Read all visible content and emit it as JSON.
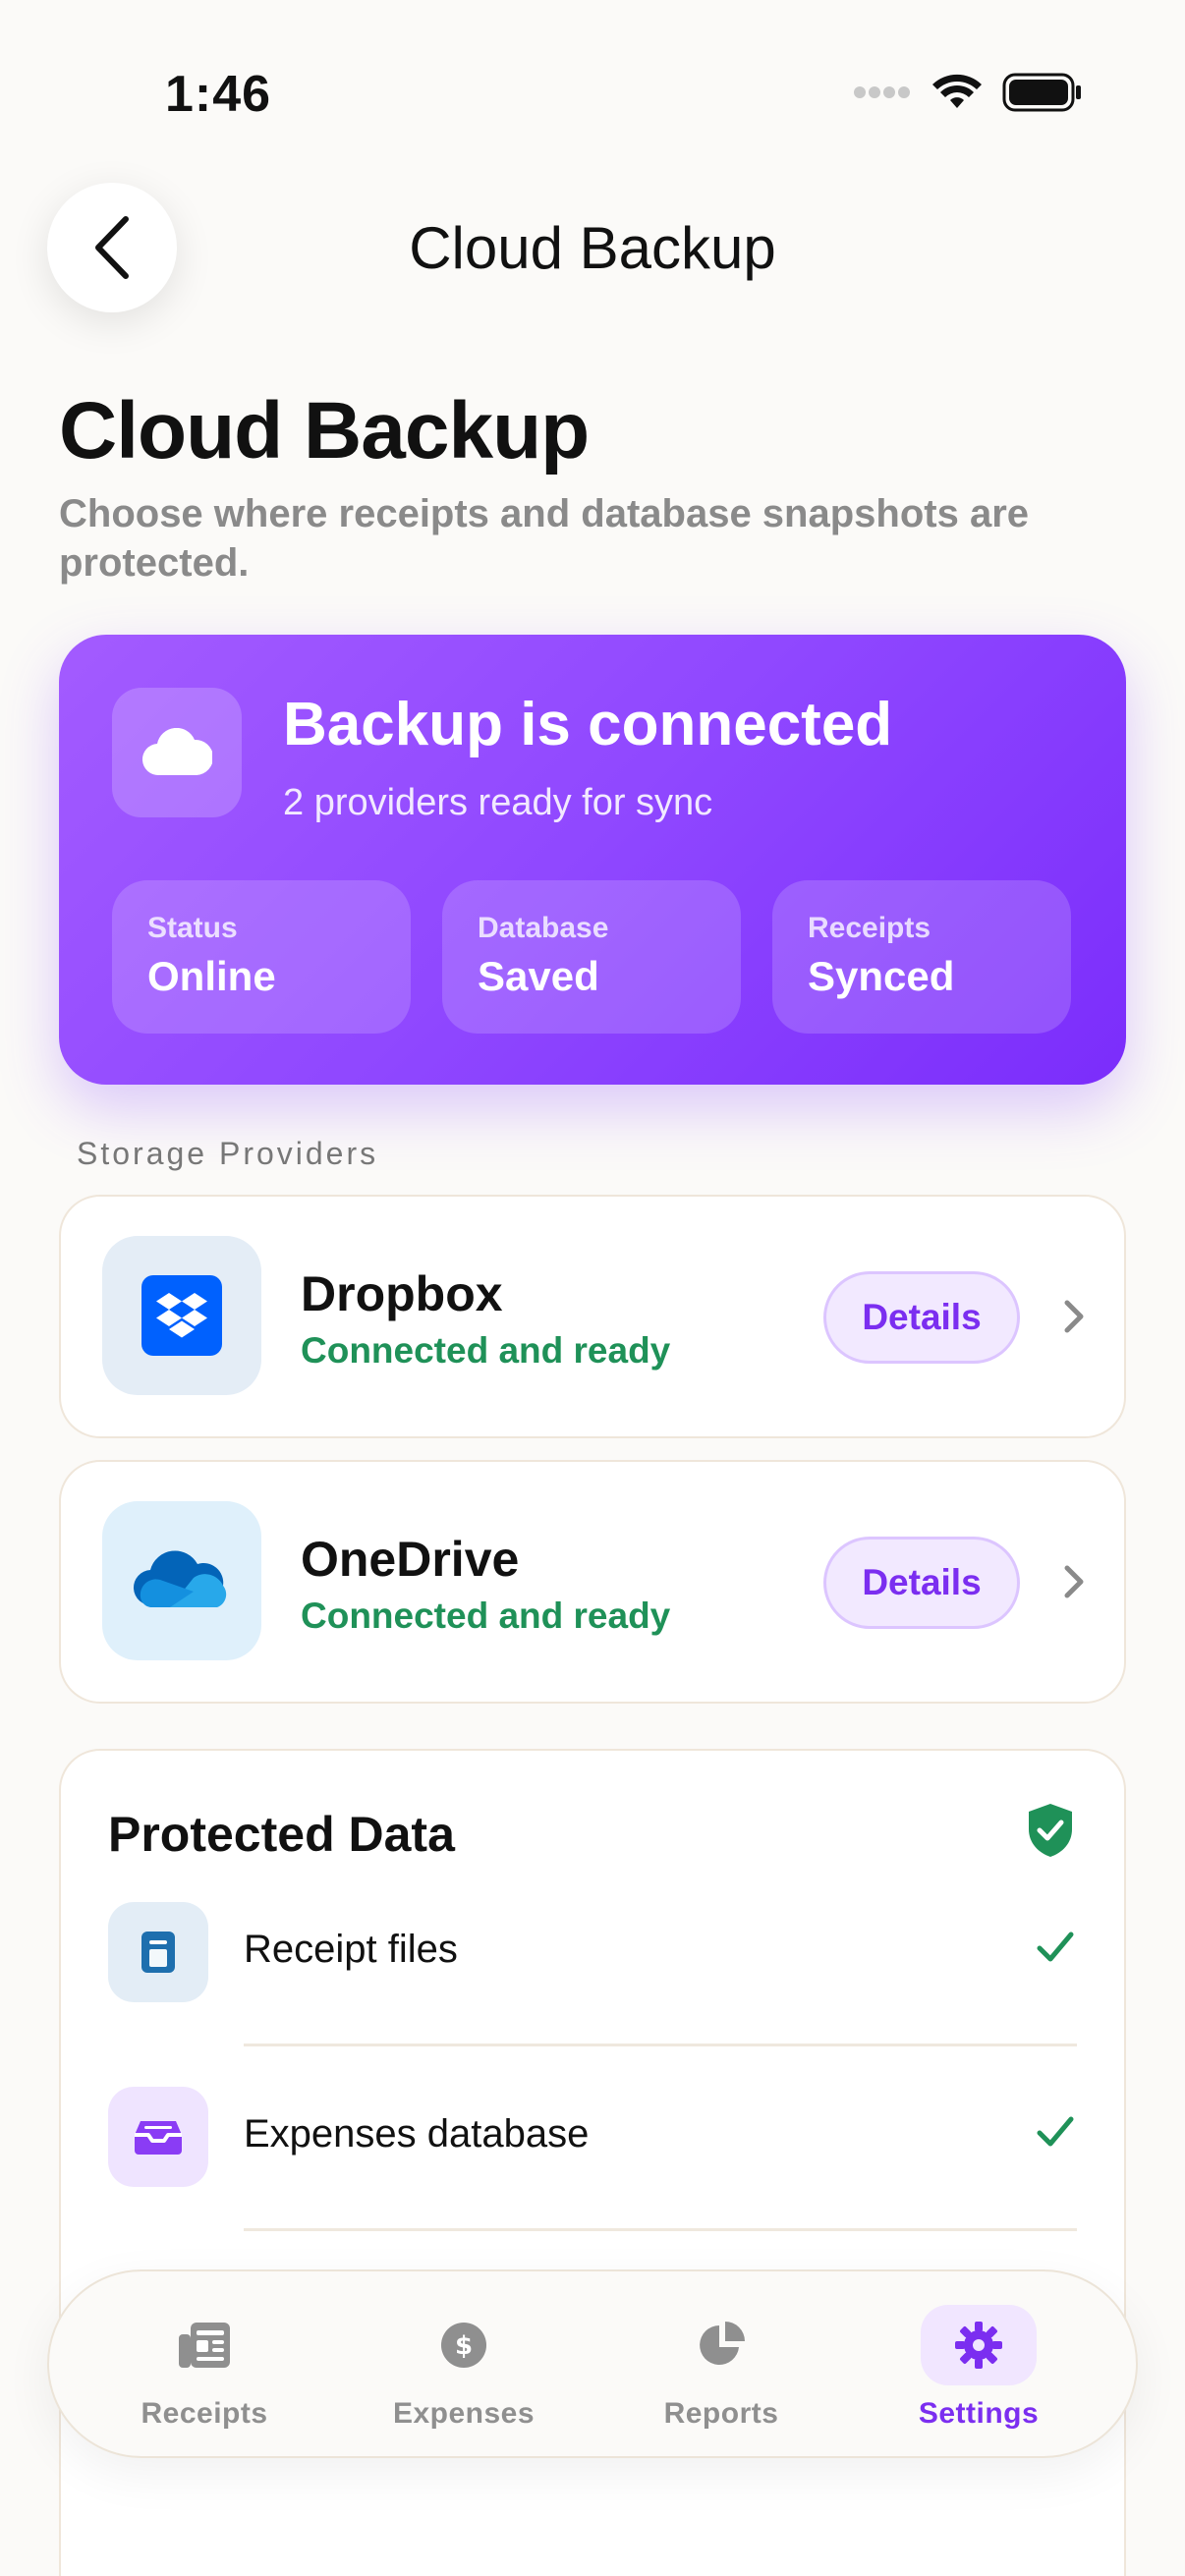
{
  "status_bar": {
    "time": "1:46"
  },
  "nav": {
    "title": "Cloud Backup"
  },
  "page": {
    "title": "Cloud Backup",
    "subtitle": "Choose where receipts and database snapshots are protected."
  },
  "hero": {
    "title": "Backup is connected",
    "subtitle": "2 providers ready for sync",
    "stats": [
      {
        "label": "Status",
        "value": "Online"
      },
      {
        "label": "Database",
        "value": "Saved"
      },
      {
        "label": "Receipts",
        "value": "Synced"
      }
    ]
  },
  "providers_section": {
    "label": "Storage Providers",
    "items": [
      {
        "name": "Dropbox",
        "status": "Connected and ready",
        "button": "Details",
        "icon": "dropbox-icon"
      },
      {
        "name": "OneDrive",
        "status": "Connected and ready",
        "button": "Details",
        "icon": "onedrive-icon"
      }
    ]
  },
  "protected": {
    "title": "Protected Data",
    "items": [
      {
        "label": "Receipt files",
        "icon": "receipt-file-icon"
      },
      {
        "label": "Expenses database",
        "icon": "inbox-tray-icon"
      }
    ]
  },
  "tabbar": {
    "tabs": [
      {
        "label": "Receipts",
        "icon": "receipts-icon"
      },
      {
        "label": "Expenses",
        "icon": "dollar-coin-icon"
      },
      {
        "label": "Reports",
        "icon": "pie-chart-icon"
      },
      {
        "label": "Settings",
        "icon": "gear-icon",
        "active": true
      }
    ]
  },
  "colors": {
    "accent": "#7B2EF0",
    "hero_gradient_start": "#A35BFF",
    "hero_gradient_end": "#7B2DFB",
    "success": "#1F9158",
    "dropbox_blue": "#0061FE"
  }
}
